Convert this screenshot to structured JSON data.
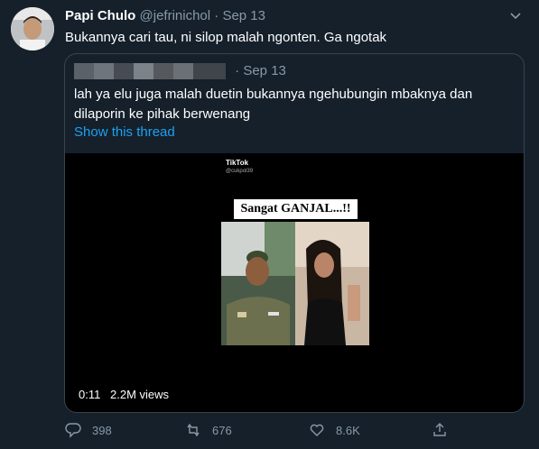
{
  "tweet": {
    "display_name": "Papi Chulo",
    "handle": "@jefrinichol",
    "separator": "·",
    "date": "Sep 13",
    "text": "Bukannya cari tau, ni silop malah ngonten. Ga ngotak"
  },
  "quote": {
    "date": "· Sep 13",
    "text": "lah ya elu juga malah duetin bukannya ngehubungin mbaknya dan dilaporin ke pihak berwenang",
    "show_thread": "Show this thread",
    "video": {
      "tiktok_logo": "TikTok",
      "tiktok_user": "@cukpol39",
      "banner": "Sangat GANJAL...!!",
      "time": "0:11",
      "views": "2.2M views"
    }
  },
  "actions": {
    "reply_count": "398",
    "retweet_count": "676",
    "like_count": "8.6K",
    "share_icon": "share-icon"
  },
  "colors": {
    "background": "#15202b",
    "secondary_text": "#8899a6",
    "link": "#1da1f2",
    "border": "#38444d"
  }
}
